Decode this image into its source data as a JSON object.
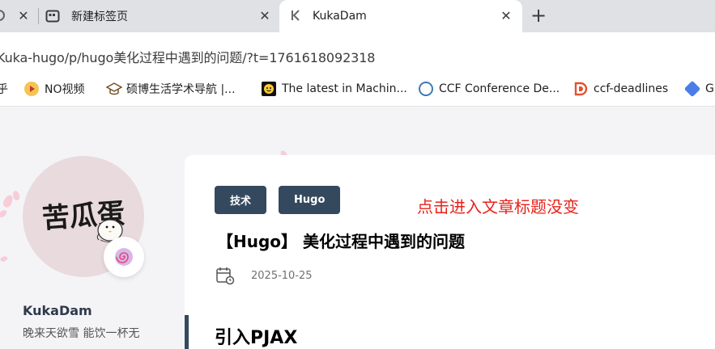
{
  "browser": {
    "tabs": [
      {
        "title": "",
        "close": "✕"
      },
      {
        "title": "新建标签页",
        "close": "✕"
      },
      {
        "title": "KukaDam",
        "close": "✕",
        "active": true
      }
    ],
    "new_tab": "+",
    "url": "Kuka-hugo/p/hugo美化过程中遇到的问题/?t=1761618092318",
    "bookmarks": [
      {
        "label": "乎"
      },
      {
        "label": "NO视频"
      },
      {
        "label": "硕博生活学术导航 |..."
      },
      {
        "label": "The latest in Machin..."
      },
      {
        "label": "CCF Conference De..."
      },
      {
        "label": "ccf-deadlines"
      },
      {
        "label": "G"
      }
    ]
  },
  "sidebar": {
    "site_name": "KukaDam",
    "subtitle": "晚来天欲雪 能饮一杯无",
    "avatar_text": "苦瓜蛋"
  },
  "article": {
    "tags": [
      "技术",
      "Hugo"
    ],
    "annotation": "点击进入文章标题没变",
    "title": "【Hugo】 美化过程中遇到的问题",
    "date": "2025-10-25",
    "section_heading": "引入PJAX"
  },
  "colors": {
    "tag_bg": "#34495e",
    "annotation": "#e8221b",
    "tabstrip": "#dfe1e5"
  }
}
